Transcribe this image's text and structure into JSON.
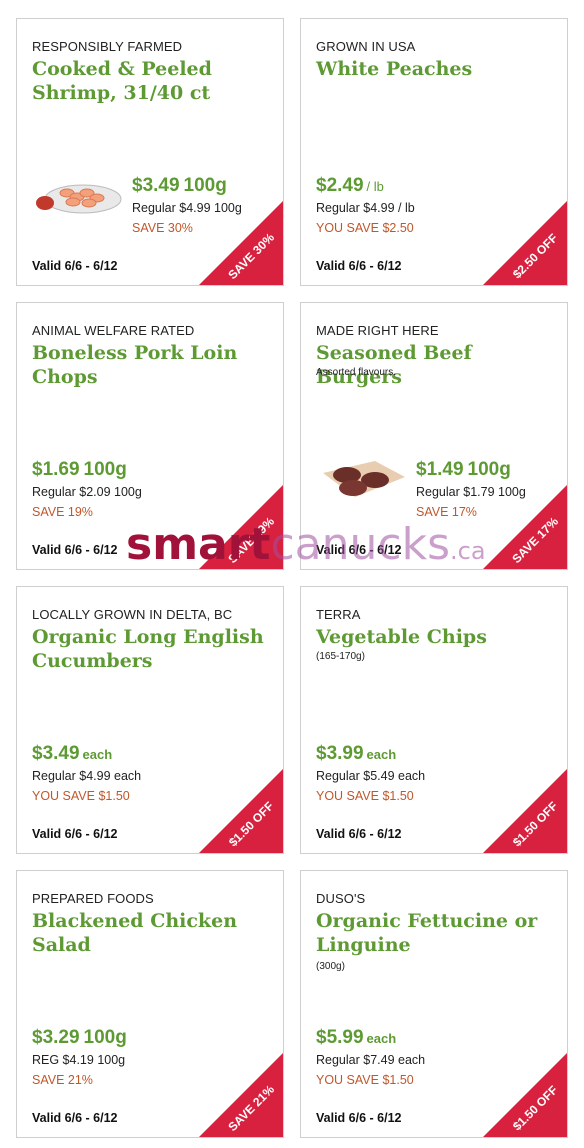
{
  "colors": {
    "accent_green": "#5e9a33",
    "save_orange": "#c0572a",
    "ribbon_red": "#d8213f",
    "watermark": "#a0123a"
  },
  "cards": [
    {
      "eyebrow": "RESPONSIBLY FARMED",
      "title": "Cooked & Peeled Shrimp, 31/40 ct",
      "subtitle": "",
      "price": "$3.49",
      "unit": "100g",
      "regular": "Regular $4.99 100g",
      "save": "SAVE 30%",
      "valid": "Valid 6/6 - 6/12",
      "ribbon": "SAVE 30%",
      "image": "shrimp-platter-icon"
    },
    {
      "eyebrow": "GROWN IN USA",
      "title": "White Peaches",
      "subtitle": "",
      "price": "$2.49",
      "unit": "/ lb",
      "regular": "Regular $4.99 / lb",
      "save": "YOU SAVE $2.50",
      "valid": "Valid 6/6 - 6/12",
      "ribbon": "$2.50 OFF",
      "image": ""
    },
    {
      "eyebrow": "ANIMAL WELFARE RATED",
      "title": "Boneless Pork Loin Chops",
      "subtitle": "",
      "price": "$1.69",
      "unit": "100g",
      "regular": "Regular $2.09 100g",
      "save": "SAVE 19%",
      "valid": "Valid 6/6 - 6/12",
      "ribbon": "SAVE 19%",
      "image": ""
    },
    {
      "eyebrow": "MADE RIGHT HERE",
      "title": "Seasoned Beef Burgers",
      "subtitle": "Assorted flavours.",
      "price": "$1.49",
      "unit": "100g",
      "regular": "Regular $1.79 100g",
      "save": "SAVE 17%",
      "valid": "Valid 6/6 - 6/12",
      "ribbon": "SAVE 17%",
      "image": "beef-patties-icon"
    },
    {
      "eyebrow": "LOCALLY GROWN IN DELTA, BC",
      "title": "Organic Long English Cucumbers",
      "subtitle": "",
      "price": "$3.49",
      "unit": "each",
      "regular": "Regular $4.99 each",
      "save": "YOU SAVE $1.50",
      "valid": "Valid 6/6 - 6/12",
      "ribbon": "$1.50 OFF",
      "image": ""
    },
    {
      "eyebrow": "TERRA",
      "title": "Vegetable Chips",
      "subtitle": "(165-170g)",
      "price": "$3.99",
      "unit": "each",
      "regular": "Regular $5.49 each",
      "save": "YOU SAVE $1.50",
      "valid": "Valid 6/6 - 6/12",
      "ribbon": "$1.50 OFF",
      "image": ""
    },
    {
      "eyebrow": "PREPARED FOODS",
      "title": "Blackened Chicken Salad",
      "subtitle": "",
      "price": "$3.29",
      "unit": "100g",
      "regular": "REG $4.19 100g",
      "save": "SAVE 21%",
      "valid": "Valid 6/6 - 6/12",
      "ribbon": "SAVE 21%",
      "image": ""
    },
    {
      "eyebrow": "DUSO'S",
      "title": "Organic Fettucine or Linguine",
      "subtitle": "(300g)",
      "price": "$5.99",
      "unit": "each",
      "regular": "Regular $7.49 each",
      "save": "YOU SAVE $1.50",
      "valid": "Valid 6/6 - 6/12",
      "ribbon": "$1.50 OFF",
      "image": ""
    }
  ],
  "watermark": {
    "part1": "smart",
    "part2": "canucks",
    "part3": ".ca"
  }
}
